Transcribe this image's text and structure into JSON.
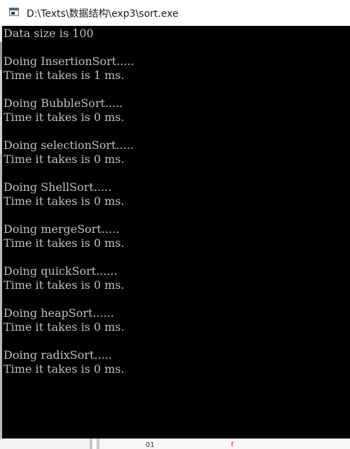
{
  "window": {
    "title": "D:\\Texts\\数据结构\\exp3\\sort.exe",
    "icon": "console-app-icon"
  },
  "console": {
    "lines": [
      "Data size is 100",
      "",
      "Doing InsertionSort.....",
      "Time it takes is 1 ms.",
      "",
      "Doing BubbleSort.....",
      "Time it takes is 0 ms.",
      "",
      "Doing selectionSort.....",
      "Time it takes is 0 ms.",
      "",
      "Doing ShellSort.....",
      "Time it takes is 0 ms.",
      "",
      "Doing mergeSort.....",
      "Time it takes is 0 ms.",
      "",
      "Doing quickSort......",
      "Time it takes is 0 ms.",
      "",
      "Doing heapSort......",
      "Time it takes is 0 ms.",
      "",
      "Doing radixSort.....",
      "Time it takes is 0 ms."
    ]
  },
  "background_fragments": {
    "bottom_left": "01",
    "bottom_right": "f"
  },
  "colors": {
    "console_background": "#000000",
    "console_text": "#c0c0c0",
    "titlebar_background": "#ffffff",
    "title_text": "#1a1a1a"
  }
}
